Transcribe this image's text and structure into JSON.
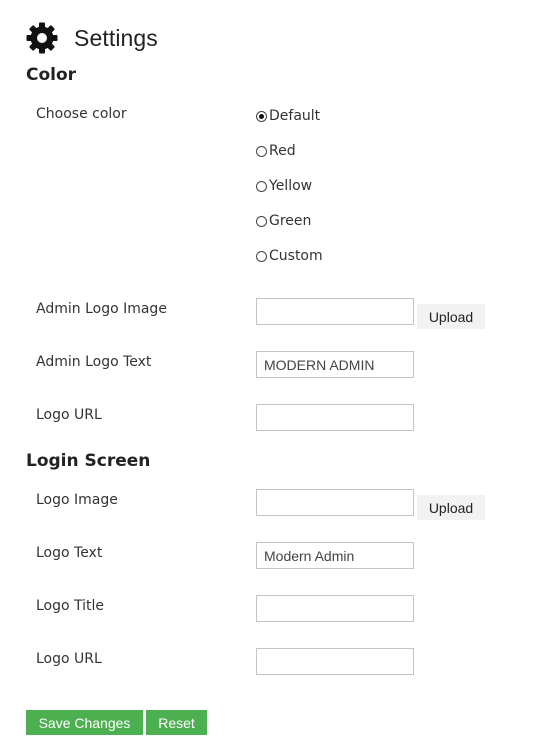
{
  "header": {
    "icon": "gear-icon",
    "title": "Settings"
  },
  "color_section": {
    "title": "Color",
    "choose_label": "Choose color",
    "options": [
      {
        "label": "Default",
        "checked": true
      },
      {
        "label": "Red",
        "checked": false
      },
      {
        "label": "Yellow",
        "checked": false
      },
      {
        "label": "Green",
        "checked": false
      },
      {
        "label": "Custom",
        "checked": false
      }
    ],
    "admin_logo_image": {
      "label": "Admin Logo Image",
      "value": "",
      "button": "Upload"
    },
    "admin_logo_text": {
      "label": "Admin Logo Text",
      "value": "MODERN ADMIN"
    },
    "logo_url": {
      "label": "Logo URL",
      "value": ""
    }
  },
  "login_section": {
    "title": "Login Screen",
    "logo_image": {
      "label": "Logo Image",
      "value": "",
      "button": "Upload"
    },
    "logo_text": {
      "label": "Logo Text",
      "value": "Modern Admin"
    },
    "logo_title": {
      "label": "Logo Title",
      "value": ""
    },
    "logo_url": {
      "label": "Logo URL",
      "value": ""
    }
  },
  "actions": {
    "save_label": "Save Changes",
    "reset_label": "Reset",
    "button_color": "#4caf50"
  }
}
